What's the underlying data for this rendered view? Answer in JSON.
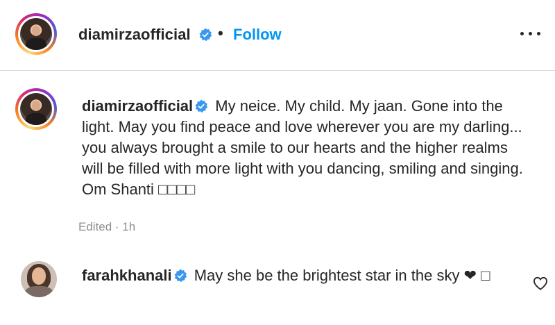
{
  "post": {
    "author": "diamirzaofficial",
    "dot": "•",
    "follow_label": "Follow"
  },
  "caption": {
    "author": "diamirzaofficial",
    "text": "My neice. My child. My jaan. Gone into the light. May you find peace and love wherever you are my darling... you always brought a smile to our hearts and the higher realms will be filled with more light with you dancing, smiling and singing. Om Shanti □□□□",
    "meta": "Edited · 1h"
  },
  "comment": {
    "author": "farahkhanali",
    "text": "May she be the brightest star in the sky ❤ □"
  },
  "icons": {
    "verified": "verified-badge-icon",
    "more": "more-options-icon",
    "like": "heart-outline-icon"
  },
  "colors": {
    "accent": "#0095f6",
    "verified": "#3897f0",
    "text": "#262626",
    "secondary": "#8e8e8e"
  }
}
